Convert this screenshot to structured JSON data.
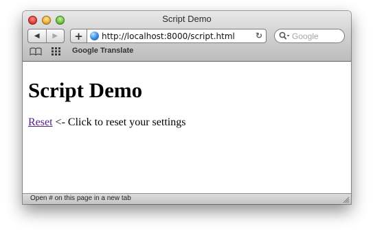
{
  "window": {
    "title": "Script Demo"
  },
  "toolbar": {
    "back_icon": "back-arrow-icon",
    "forward_icon": "forward-arrow-icon",
    "add_bookmark_label": "+",
    "url": "http://localhost:8000/script.html",
    "reload_icon": "reload-icon",
    "search_placeholder": "Google"
  },
  "bookmarks_bar": {
    "items": [
      {
        "label": "Google Translate"
      }
    ]
  },
  "page": {
    "heading": "Script Demo",
    "reset_link": "Reset",
    "reset_description": " <- Click to reset your settings"
  },
  "statusbar": {
    "text": "Open # on this page in a new tab"
  },
  "colors": {
    "link_visited": "#551a8b",
    "close": "#e0453b",
    "minimize": "#f0b53b",
    "zoom": "#77c64a"
  }
}
